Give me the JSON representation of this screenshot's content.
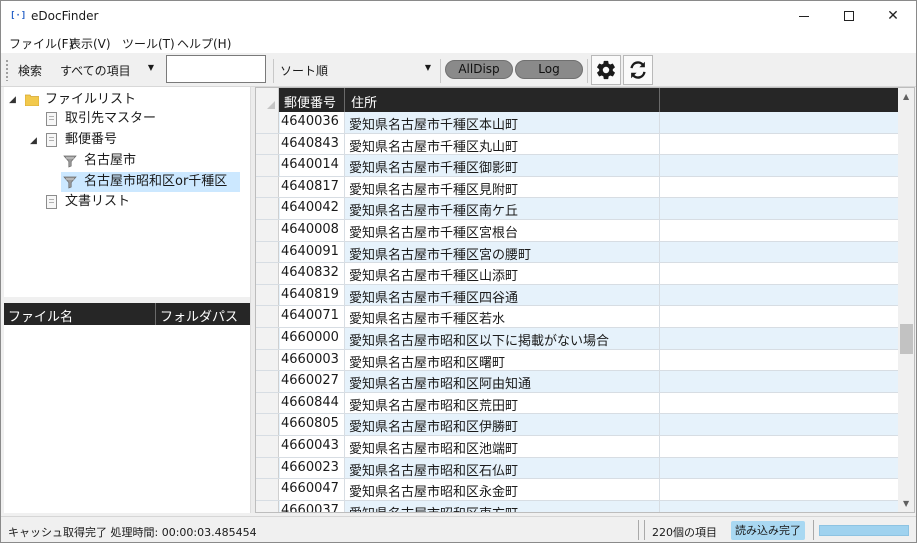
{
  "window": {
    "title": "eDocFinder",
    "icon": "app-bracket-icon"
  },
  "menu": [
    "ファイル(F)",
    "表示(V)",
    "ツール(T)",
    "ヘルプ(H)"
  ],
  "toolbar": {
    "search_label": "検索",
    "search_scope": "すべての項目",
    "search_value": "",
    "sort_label": "ソート順",
    "sort_value": "",
    "alldisp_label": "AllDisp",
    "log_label": "Log",
    "settings_icon": "gear-icon",
    "refresh_icon": "refresh-icon"
  },
  "tree": {
    "root": "ファイルリスト",
    "items": [
      {
        "label": "取引先マスター",
        "icon": "document-icon"
      },
      {
        "label": "郵便番号",
        "icon": "document-icon"
      },
      {
        "label": "名古屋市",
        "icon": "filter-icon"
      },
      {
        "label": "名古屋市昭和区or千種区",
        "icon": "filter-icon",
        "selected": true
      },
      {
        "label": "文書リスト",
        "icon": "document-icon"
      }
    ]
  },
  "file_list": {
    "col_filename": "ファイル名",
    "col_folderpath": "フォルダパス"
  },
  "grid": {
    "col_zip": "郵便番号",
    "col_address": "住所",
    "rows": [
      {
        "zip": "4640036",
        "address": "愛知県名古屋市千種区本山町"
      },
      {
        "zip": "4640843",
        "address": "愛知県名古屋市千種区丸山町"
      },
      {
        "zip": "4640014",
        "address": "愛知県名古屋市千種区御影町"
      },
      {
        "zip": "4640817",
        "address": "愛知県名古屋市千種区見附町"
      },
      {
        "zip": "4640042",
        "address": "愛知県名古屋市千種区南ケ丘"
      },
      {
        "zip": "4640008",
        "address": "愛知県名古屋市千種区宮根台"
      },
      {
        "zip": "4640091",
        "address": "愛知県名古屋市千種区宮の腰町"
      },
      {
        "zip": "4640832",
        "address": "愛知県名古屋市千種区山添町"
      },
      {
        "zip": "4640819",
        "address": "愛知県名古屋市千種区四谷通"
      },
      {
        "zip": "4640071",
        "address": "愛知県名古屋市千種区若水"
      },
      {
        "zip": "4660000",
        "address": "愛知県名古屋市昭和区以下に掲載がない場合"
      },
      {
        "zip": "4660003",
        "address": "愛知県名古屋市昭和区曙町"
      },
      {
        "zip": "4660027",
        "address": "愛知県名古屋市昭和区阿由知通"
      },
      {
        "zip": "4660844",
        "address": "愛知県名古屋市昭和区荒田町"
      },
      {
        "zip": "4660805",
        "address": "愛知県名古屋市昭和区伊勝町"
      },
      {
        "zip": "4660043",
        "address": "愛知県名古屋市昭和区池端町"
      },
      {
        "zip": "4660023",
        "address": "愛知県名古屋市昭和区石仏町"
      },
      {
        "zip": "4660047",
        "address": "愛知県名古屋市昭和区永金町"
      },
      {
        "zip": "4660037",
        "address": "愛知県名古屋市昭和区東方町"
      }
    ]
  },
  "status": {
    "message": "キャッシュ取得完了 処理時間: 00:00:03.485454",
    "count": "220個の項目",
    "state": "読み込み完了",
    "progress": 1.0
  },
  "colors": {
    "row_alt": "#e6f2fb",
    "header_bg": "#262626",
    "selected": "#cce8ff",
    "progress": "#9fd2ef"
  }
}
